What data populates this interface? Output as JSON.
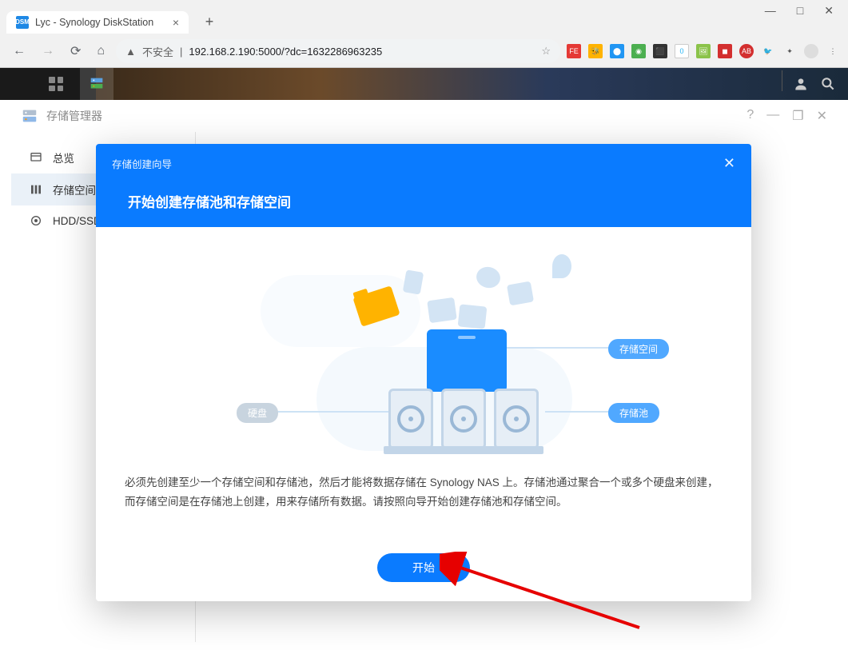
{
  "window": {
    "min": "—",
    "max": "□",
    "close": "✕"
  },
  "tab": {
    "favicon_text": "DSM",
    "title": "Lyc - Synology DiskStation"
  },
  "address": {
    "not_secure": "不安全",
    "separator": "|",
    "url": "192.168.2.190:5000/?dc=1632286963235"
  },
  "dsm": {
    "storage_manager_title": "存储管理器",
    "sidebar": [
      {
        "label": "总览"
      },
      {
        "label": "存储空间"
      },
      {
        "label": "HDD/SSD"
      }
    ]
  },
  "wizard": {
    "breadcrumb": "存储创建向导",
    "title": "开始创建存储池和存储空间",
    "label_volume": "存储空间",
    "label_pool": "存储池",
    "label_disk": "硬盘",
    "description": "必须先创建至少一个存储空间和存储池，然后才能将数据存储在 Synology NAS 上。存储池通过聚合一个或多个硬盘来创建，而存储空间是在存储池上创建，用来存储所有数据。请按照向导开始创建存储池和存储空间。",
    "start_button": "开始"
  }
}
